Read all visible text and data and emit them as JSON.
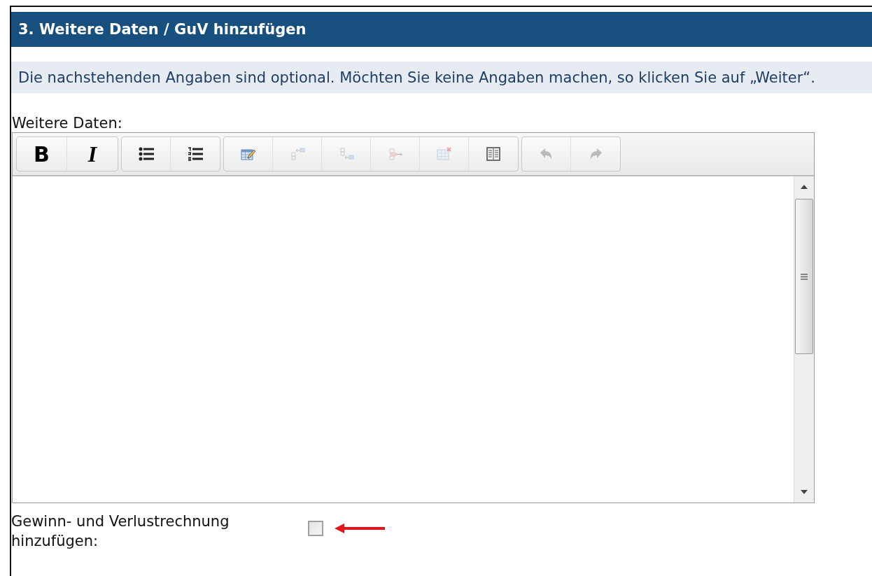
{
  "section": {
    "title": "3. Weitere Daten / GuV hinzufügen"
  },
  "notice": {
    "text": "Die nachstehenden Angaben sind optional. Möchten Sie keine Angaben machen, so klicken Sie auf „Weiter“."
  },
  "editor": {
    "label": "Weitere Daten:",
    "toolbar": [
      [
        {
          "kind": "bold",
          "text": "B",
          "disabled": false
        },
        {
          "kind": "italic",
          "text": "I",
          "disabled": false
        }
      ],
      [
        {
          "kind": "bullets",
          "disabled": false
        },
        {
          "kind": "numbers",
          "disabled": false
        }
      ],
      [
        {
          "kind": "table-edit",
          "disabled": false
        },
        {
          "kind": "row-above",
          "disabled": true
        },
        {
          "kind": "row-below",
          "disabled": true
        },
        {
          "kind": "column",
          "disabled": true
        },
        {
          "kind": "table-delete",
          "disabled": true
        },
        {
          "kind": "table-props",
          "disabled": false
        }
      ],
      [
        {
          "kind": "undo",
          "disabled": true
        },
        {
          "kind": "redo",
          "disabled": true
        }
      ]
    ]
  },
  "checkbox": {
    "label": "Gewinn- und Verlustrechnung hinzufügen:",
    "checked": false
  }
}
